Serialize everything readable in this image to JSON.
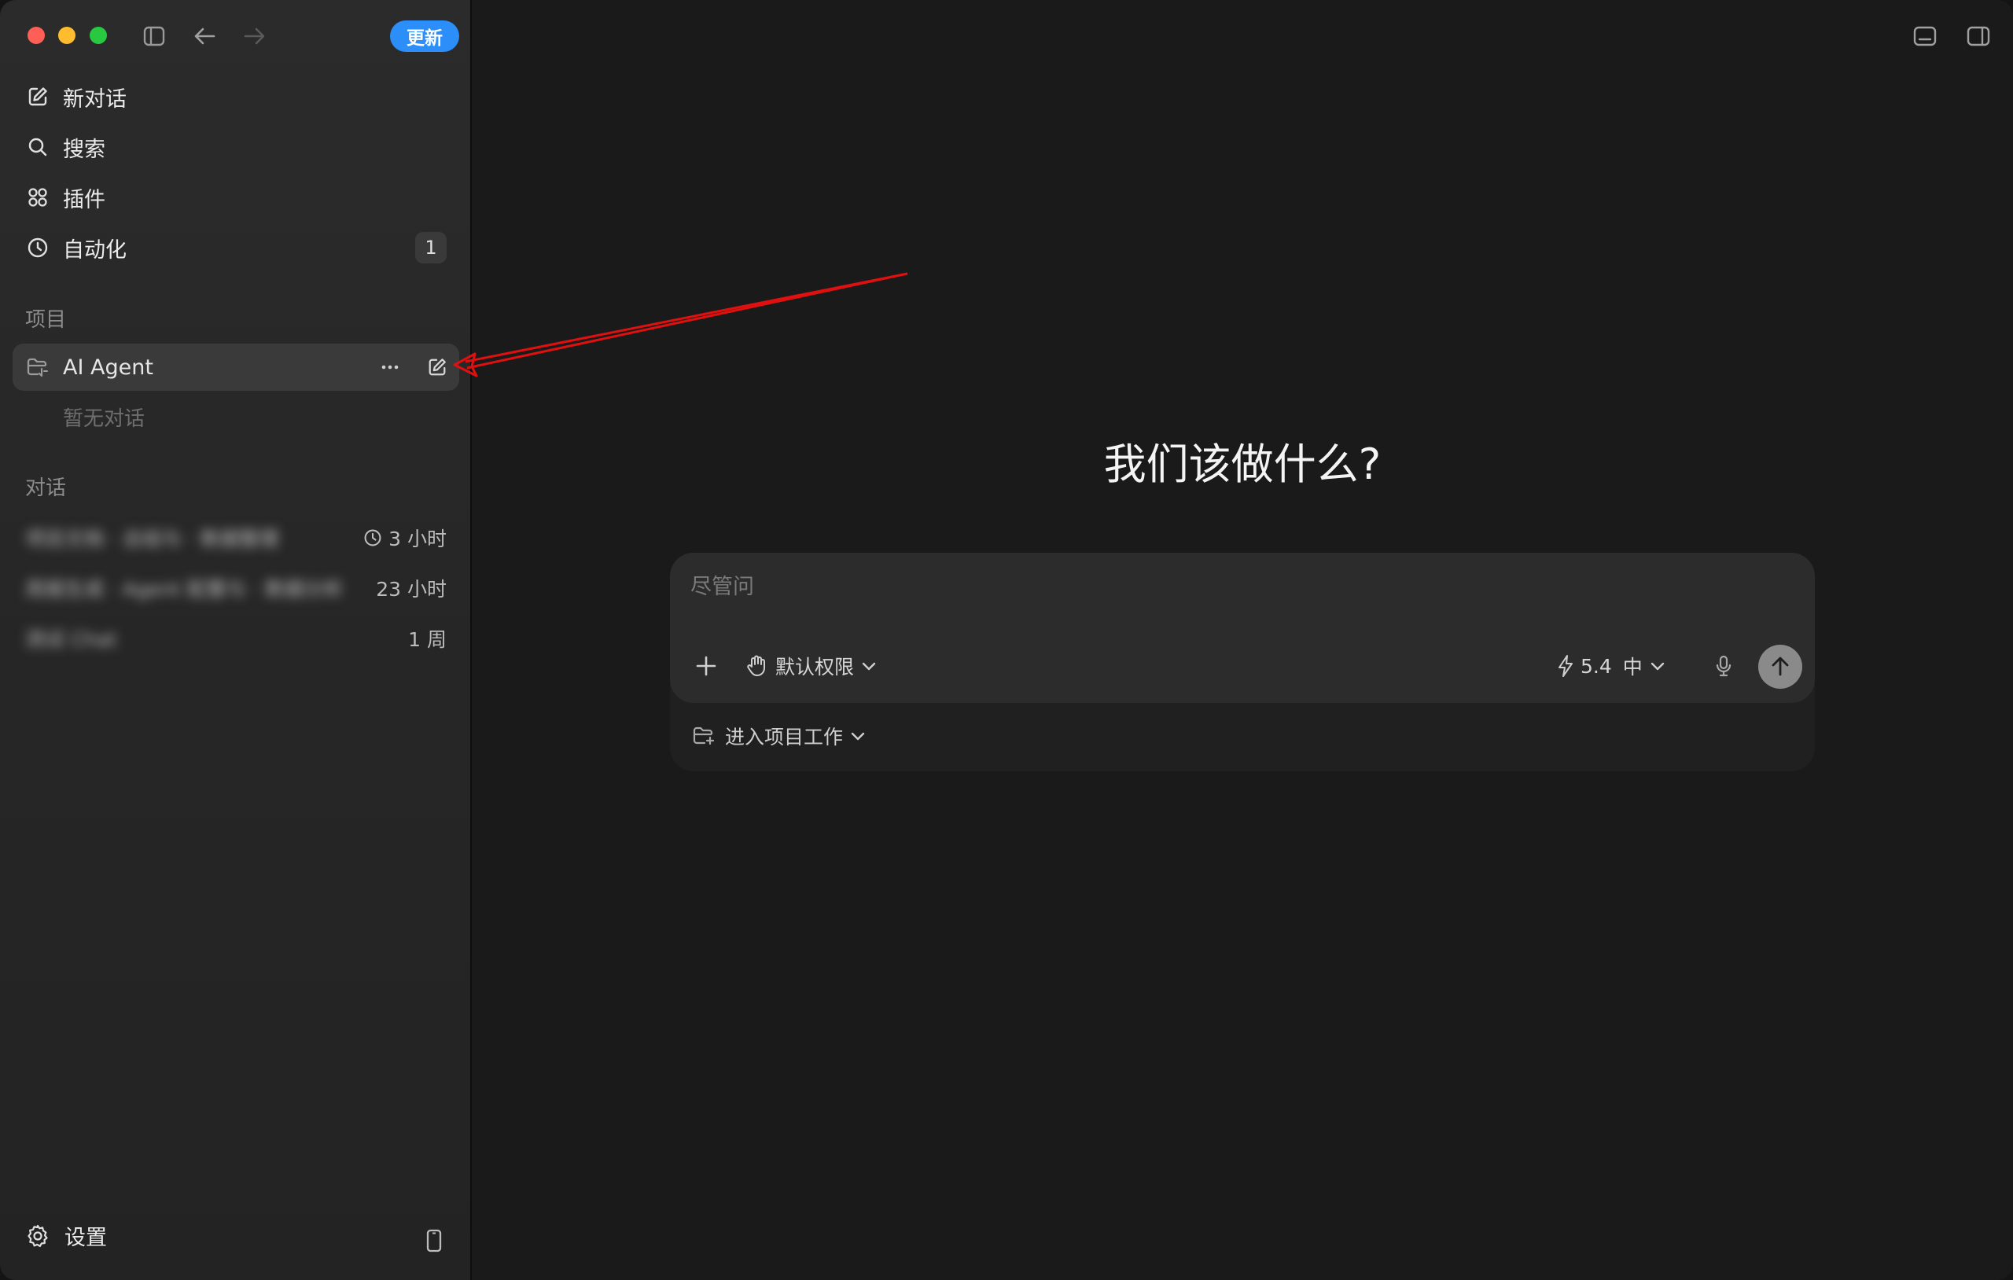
{
  "app": {
    "update_label": "更新"
  },
  "sidebar": {
    "nav": [
      {
        "label": "新对话",
        "icon": "compose-icon"
      },
      {
        "label": "搜索",
        "icon": "search-icon"
      },
      {
        "label": "插件",
        "icon": "plugins-grid-icon"
      },
      {
        "label": "自动化",
        "icon": "clock-icon",
        "badge": "1"
      }
    ],
    "projects_header": "项目",
    "project": {
      "name": "AI Agent",
      "empty_text": "暂无对话"
    },
    "conversations_header": "对话",
    "conversations": [
      {
        "title": "项目文档 · 总结与 · 数据整理",
        "time": "3 小时",
        "has_clock": true
      },
      {
        "title": "周报生成 · Agent 配置与 · 数据分析",
        "time": "23 小时",
        "has_clock": false
      },
      {
        "title": "测试 Chat",
        "time": "1 周",
        "has_clock": false
      }
    ],
    "settings_label": "设置"
  },
  "main": {
    "headline": "我们该做什么?",
    "composer": {
      "placeholder": "尽管问",
      "permission_label": "默认权限",
      "model_version": "5.4",
      "reasoning_level": "中"
    },
    "project_work_label": "进入项目工作"
  },
  "colors": {
    "accent": "#2c8ef8",
    "annotation_arrow": "#e01010"
  }
}
